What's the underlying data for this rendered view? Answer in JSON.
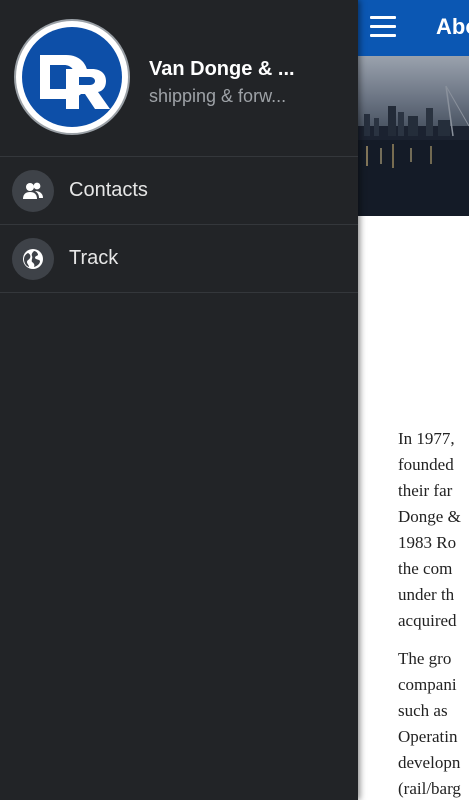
{
  "app_bar": {
    "title": "Abo"
  },
  "drawer": {
    "company_name": "Van Donge & ...",
    "company_subtitle": "shipping & forw...",
    "logo_text": "DR",
    "items": [
      {
        "label": "Contacts",
        "icon": "contacts-icon"
      },
      {
        "label": "Track",
        "icon": "globe-icon"
      }
    ]
  },
  "article": {
    "paragraph_1": [
      "In 1977,",
      "founded",
      "their far",
      "Donge &",
      "1983 Ro",
      "the com",
      "under th",
      "acquired"
    ],
    "paragraph_2": [
      "The gro",
      "compani",
      "such as",
      "Operatin",
      "developn",
      "(rail/barg"
    ]
  },
  "colors": {
    "app_bar": "#0b57b3",
    "drawer_bg": "#222427",
    "logo_blue": "#0d4fa8"
  }
}
